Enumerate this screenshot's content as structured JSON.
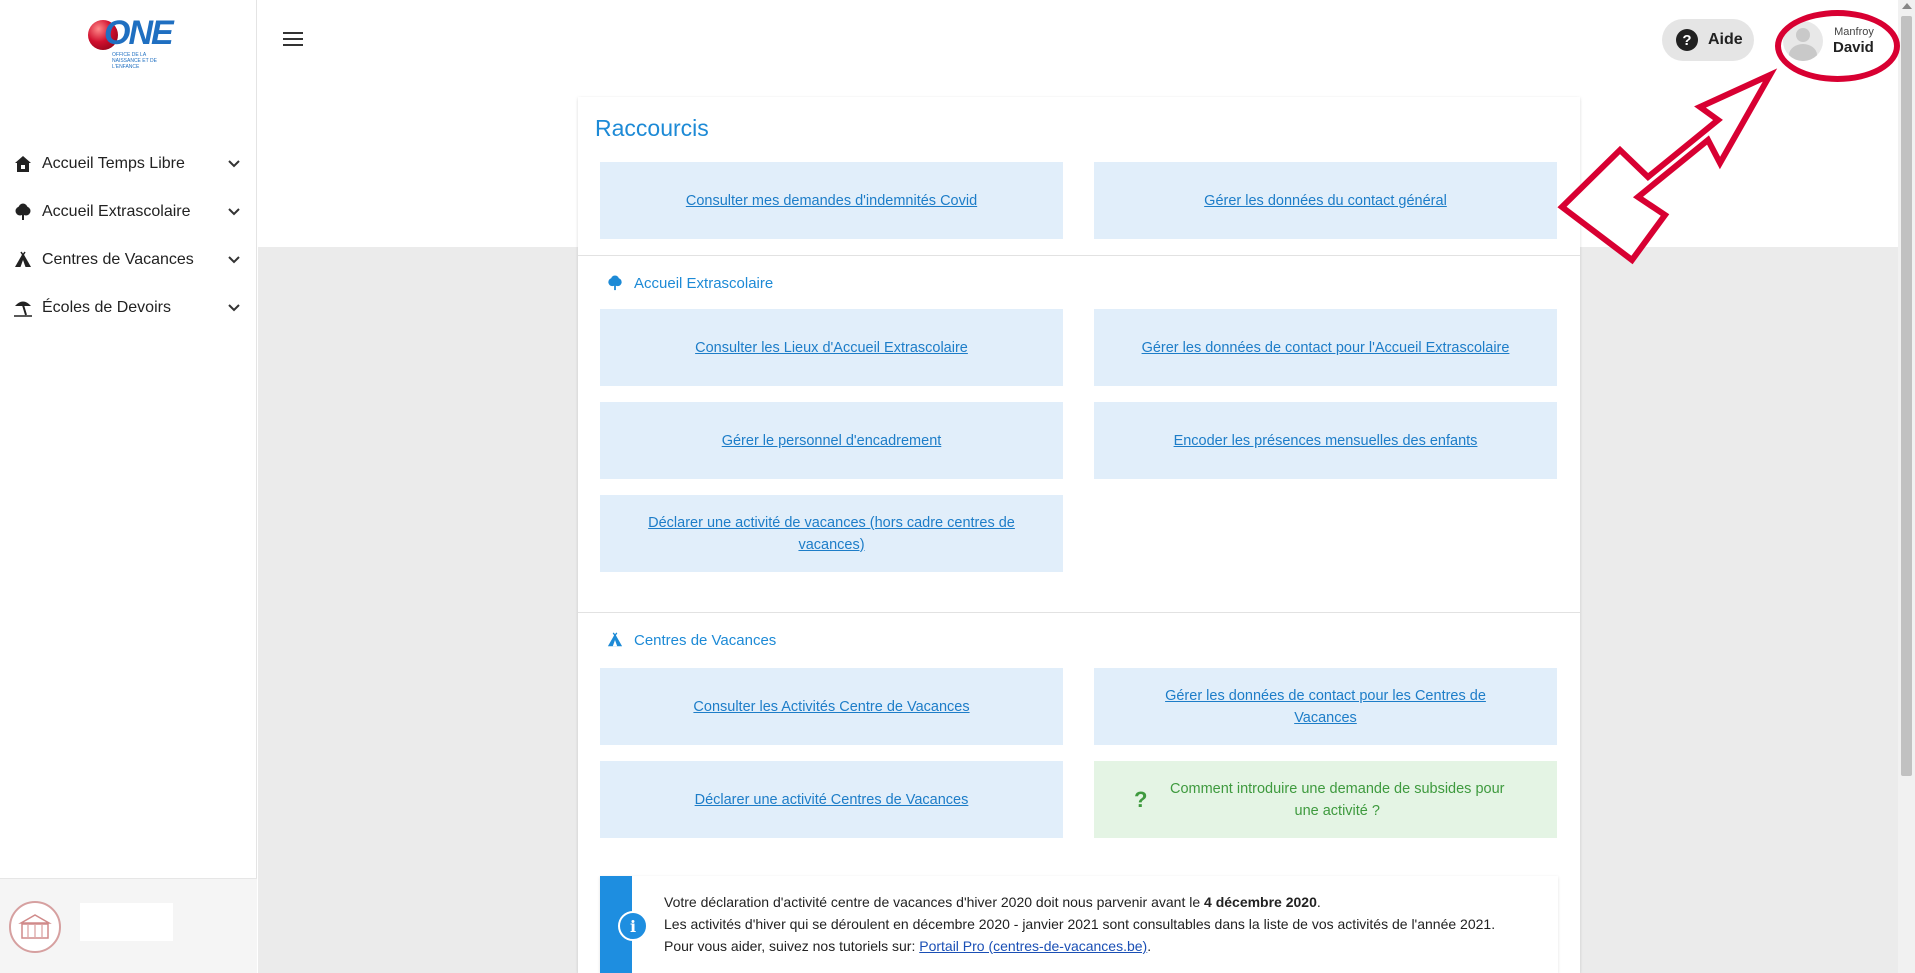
{
  "logo": {
    "letters": "ONE",
    "subtitle": "OFFICE DE LA NAISSANCE ET DE L'ENFANCE"
  },
  "sidebar": {
    "items": [
      {
        "label": "Accueil Temps Libre",
        "icon": "house-icon"
      },
      {
        "label": "Accueil Extrascolaire",
        "icon": "tree-icon"
      },
      {
        "label": "Centres de Vacances",
        "icon": "tent-icon"
      },
      {
        "label": "Écoles de Devoirs",
        "icon": "beach-umbrella-icon"
      }
    ]
  },
  "header": {
    "help_label": "Aide",
    "user_first": "Manfroy",
    "user_last": "David"
  },
  "main": {
    "title": "Raccourcis",
    "general": {
      "tiles": [
        "Consulter mes demandes d'indemnités Covid",
        "Gérer les données du contact général"
      ]
    },
    "extrascolaire": {
      "heading": "Accueil Extrascolaire",
      "tiles": [
        "Consulter les Lieux d'Accueil Extrascolaire",
        "Gérer les données de contact pour l'Accueil Extrascolaire",
        "Gérer le personnel d'encadrement",
        "Encoder les présences mensuelles des enfants",
        "Déclarer une activité de vacances (hors cadre centres de vacances)"
      ]
    },
    "vacances": {
      "heading": "Centres de Vacances",
      "tiles": [
        "Consulter les Activités Centre de Vacances",
        "Gérer les données de contact pour les Centres de Vacances",
        "Déclarer une activité Centres de Vacances"
      ],
      "help_tile": "Comment introduire une demande de subsides pour une activité ?"
    },
    "info": {
      "line1_prefix": "Votre déclaration d'activité centre de vacances d'hiver 2020 doit nous parvenir avant le ",
      "line1_bold": "4 décembre 2020",
      "line1_suffix": ".",
      "line2": "Les activités d'hiver qui se déroulent en décembre 2020 - janvier 2021 sont consultables dans la liste de vos activités de l'année 2021.",
      "line3_prefix": "Pour vous aider, suivez nos tutoriels sur: ",
      "line3_link": "Portail Pro (centres-de-vacances.be)",
      "line3_suffix": "."
    }
  },
  "colors": {
    "accent": "#1d8ad6",
    "tile_bg": "#e1eefa",
    "help_tile_bg": "#e4f4e4",
    "annotation": "#d80032"
  }
}
